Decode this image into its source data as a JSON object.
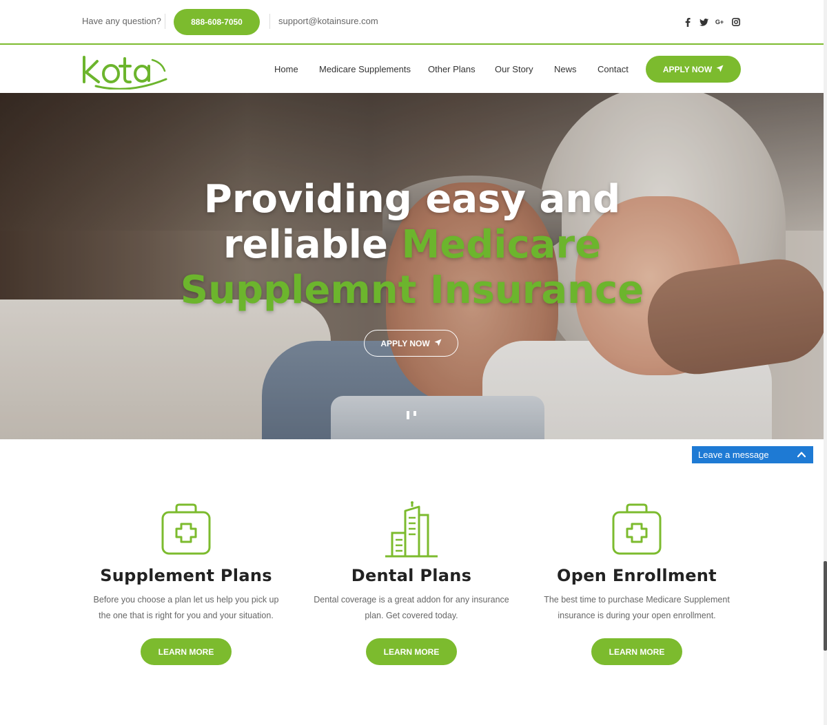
{
  "topbar": {
    "question": "Have any question?",
    "phone": "888-608-7050",
    "email": "support@kotainsure.com",
    "social": [
      {
        "name": "facebook-icon",
        "glyph": "f"
      },
      {
        "name": "twitter-icon",
        "glyph": "t"
      },
      {
        "name": "google-plus-icon",
        "glyph": "G+"
      },
      {
        "name": "instagram-icon",
        "glyph": "ig"
      }
    ]
  },
  "brand": {
    "logo_text": "Kota",
    "accent_color": "#7cbb2e"
  },
  "nav": {
    "items": [
      "Home",
      "Medicare Supplements",
      "Other Plans",
      "Our Story",
      "News",
      "Contact"
    ],
    "apply_label": "APPLY NOW"
  },
  "hero": {
    "line1": "Providing easy and",
    "line2_white": "reliable",
    "line2_green": "Medicare",
    "line3_green": "Supplemnt Insurance",
    "button_label": "APPLY NOW"
  },
  "chat": {
    "label": "Leave a message",
    "color": "#1e7ad4"
  },
  "features": [
    {
      "icon": "medical-kit-icon",
      "title": "Supplement Plans",
      "line1": "Before you choose a plan let us help you pick up",
      "line2": "the one that is right for you and your situation.",
      "button": "LEARN MORE"
    },
    {
      "icon": "building-icon",
      "title": "Dental Plans",
      "line1": "Dental coverage is a great addon for any insurance",
      "line2": "plan. Get covered today.",
      "button": "LEARN MORE"
    },
    {
      "icon": "medical-kit-icon",
      "title": "Open Enrollment",
      "line1": "The best time to purchase Medicare Supplement",
      "line2": "insurance is during your open enrollment.",
      "button": "LEARN MORE"
    }
  ]
}
